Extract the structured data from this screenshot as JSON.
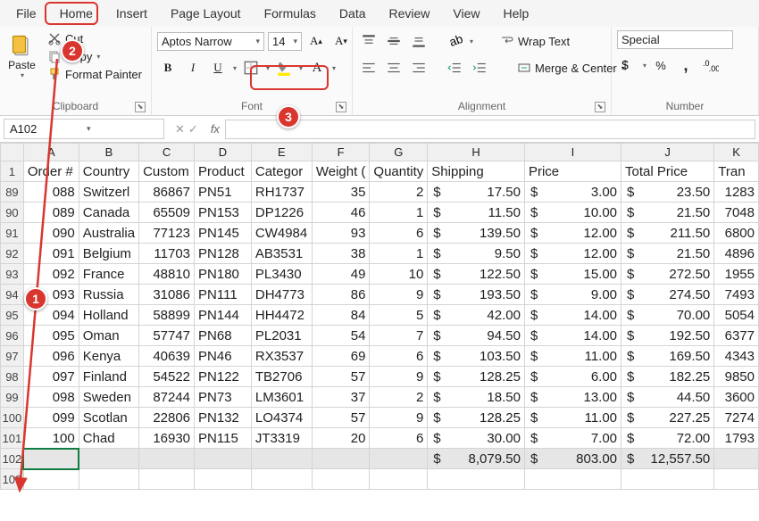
{
  "menu": {
    "items": [
      "File",
      "Home",
      "Insert",
      "Page Layout",
      "Formulas",
      "Data",
      "Review",
      "View",
      "Help"
    ],
    "active": "Home"
  },
  "ribbon": {
    "clipboard": {
      "paste": "Paste",
      "cut": "Cut",
      "copy": "Copy",
      "format_painter": "Format Painter",
      "label": "Clipboard"
    },
    "font": {
      "name": "Aptos Narrow",
      "size": "14",
      "bold": "B",
      "italic": "I",
      "underline": "U",
      "label": "Font"
    },
    "alignment": {
      "wrap": "Wrap Text",
      "merge": "Merge & Center",
      "label": "Alignment"
    },
    "number": {
      "format": "Special",
      "label": "Number"
    }
  },
  "namebox": "A102",
  "headers": [
    "Order #",
    "Country",
    "Custom",
    "Product",
    "Categor",
    "Weight (",
    "Quantity",
    "Shipping",
    "Price",
    "Total Price",
    "Tran"
  ],
  "cols": [
    "A",
    "B",
    "C",
    "D",
    "E",
    "F",
    "G",
    "H",
    "I",
    "J",
    "K"
  ],
  "rows": [
    {
      "n": 89,
      "d": [
        "088",
        "Switzerl",
        "86867",
        "PN51",
        "RH1737",
        "35",
        "2",
        "17.50",
        "3.00",
        "23.50",
        "1283"
      ]
    },
    {
      "n": 90,
      "d": [
        "089",
        "Canada",
        "65509",
        "PN153",
        "DP1226",
        "46",
        "1",
        "11.50",
        "10.00",
        "21.50",
        "7048"
      ]
    },
    {
      "n": 91,
      "d": [
        "090",
        "Australia",
        "77123",
        "PN145",
        "CW4984",
        "93",
        "6",
        "139.50",
        "12.00",
        "211.50",
        "6800"
      ]
    },
    {
      "n": 92,
      "d": [
        "091",
        "Belgium",
        "11703",
        "PN128",
        "AB3531",
        "38",
        "1",
        "9.50",
        "12.00",
        "21.50",
        "4896"
      ]
    },
    {
      "n": 93,
      "d": [
        "092",
        "France",
        "48810",
        "PN180",
        "PL3430",
        "49",
        "10",
        "122.50",
        "15.00",
        "272.50",
        "1955"
      ]
    },
    {
      "n": 94,
      "d": [
        "093",
        "Russia",
        "31086",
        "PN111",
        "DH4773",
        "86",
        "9",
        "193.50",
        "9.00",
        "274.50",
        "7493"
      ]
    },
    {
      "n": 95,
      "d": [
        "094",
        "Holland",
        "58899",
        "PN144",
        "HH4472",
        "84",
        "5",
        "42.00",
        "14.00",
        "70.00",
        "5054"
      ]
    },
    {
      "n": 96,
      "d": [
        "095",
        "Oman",
        "57747",
        "PN68",
        "PL2031",
        "54",
        "7",
        "94.50",
        "14.00",
        "192.50",
        "6377"
      ]
    },
    {
      "n": 97,
      "d": [
        "096",
        "Kenya",
        "40639",
        "PN46",
        "RX3537",
        "69",
        "6",
        "103.50",
        "11.00",
        "169.50",
        "4343"
      ]
    },
    {
      "n": 98,
      "d": [
        "097",
        "Finland",
        "54522",
        "PN122",
        "TB2706",
        "57",
        "9",
        "128.25",
        "6.00",
        "182.25",
        "9850"
      ]
    },
    {
      "n": 99,
      "d": [
        "098",
        "Sweden",
        "87244",
        "PN73",
        "LM3601",
        "37",
        "2",
        "18.50",
        "13.00",
        "44.50",
        "3600"
      ]
    },
    {
      "n": 100,
      "d": [
        "099",
        "Scotlan",
        "22806",
        "PN132",
        "LO4374",
        "57",
        "9",
        "128.25",
        "11.00",
        "227.25",
        "7274"
      ]
    },
    {
      "n": 101,
      "d": [
        "100",
        "Chad",
        "16930",
        "PN115",
        "JT3319",
        "20",
        "6",
        "30.00",
        "7.00",
        "72.00",
        "1793"
      ]
    }
  ],
  "totals": {
    "n": 102,
    "shipping": "8,079.50",
    "price": "803.00",
    "total": "12,557.50"
  },
  "last_row": 103,
  "callouts": {
    "c1": "1",
    "c2": "2",
    "c3": "3"
  }
}
